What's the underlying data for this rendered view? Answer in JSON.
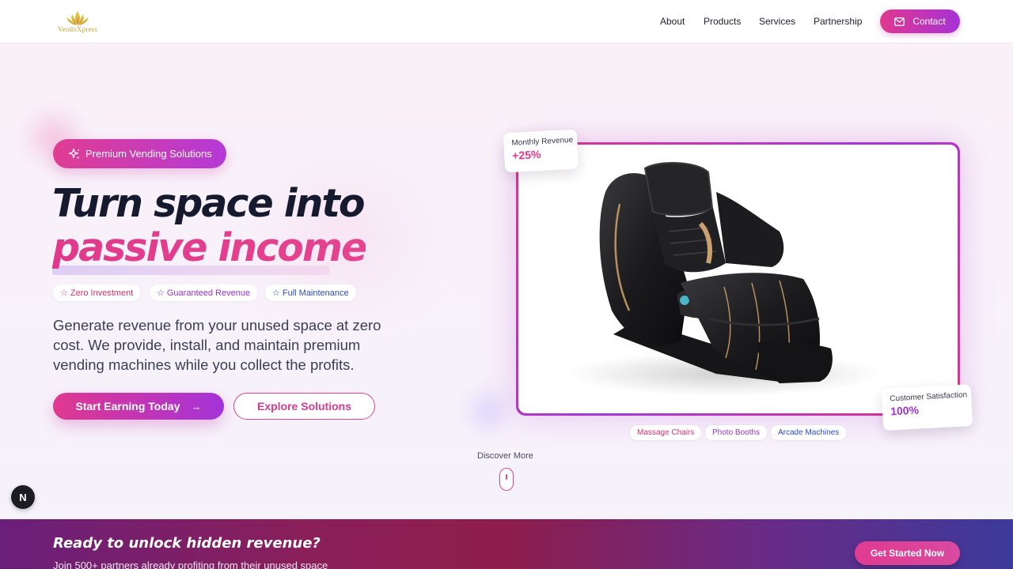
{
  "header": {
    "logo_text": "VendoXpress",
    "nav": [
      {
        "label": "About"
      },
      {
        "label": "Products"
      },
      {
        "label": "Services"
      },
      {
        "label": "Partnership"
      }
    ],
    "contact_label": "Contact"
  },
  "hero": {
    "badge": "Premium Vending Solutions",
    "headline_line1": "Turn space into",
    "headline_line2": "passive income",
    "pills": [
      {
        "label": "Zero Investment",
        "color": "#d6336f"
      },
      {
        "label": "Guaranteed Revenue",
        "color": "#9b34c6"
      },
      {
        "label": "Full Maintenance",
        "color": "#2c4cc4"
      }
    ],
    "description": "Generate revenue from your unused space at zero cost. We provide, install, and maintain premium vending machines while you collect the profits.",
    "primary_cta": "Start Earning Today",
    "secondary_cta": "Explore Solutions"
  },
  "showcase": {
    "revenue_label": "Monthly Revenue",
    "revenue_value": "+25%",
    "satisfaction_label": "Customer Satisfaction",
    "satisfaction_value": "100%",
    "product_image": "black-massage-chair",
    "tags": [
      {
        "label": "Massage Chairs",
        "color": "#d6336f"
      },
      {
        "label": "Photo Booths",
        "color": "#9b34c6"
      },
      {
        "label": "Arcade Machines",
        "color": "#2c4cc4"
      }
    ]
  },
  "discover_label": "Discover More",
  "dev_badge": "N",
  "cta": {
    "title": "Ready to unlock hidden revenue?",
    "subtitle": "Join 500+ partners already profiting from their unused space",
    "button": "Get Started Now"
  },
  "colors": {
    "brand_pink": "#e0388f",
    "brand_purple": "#a533d8",
    "heading_dark": "#151a2e"
  }
}
